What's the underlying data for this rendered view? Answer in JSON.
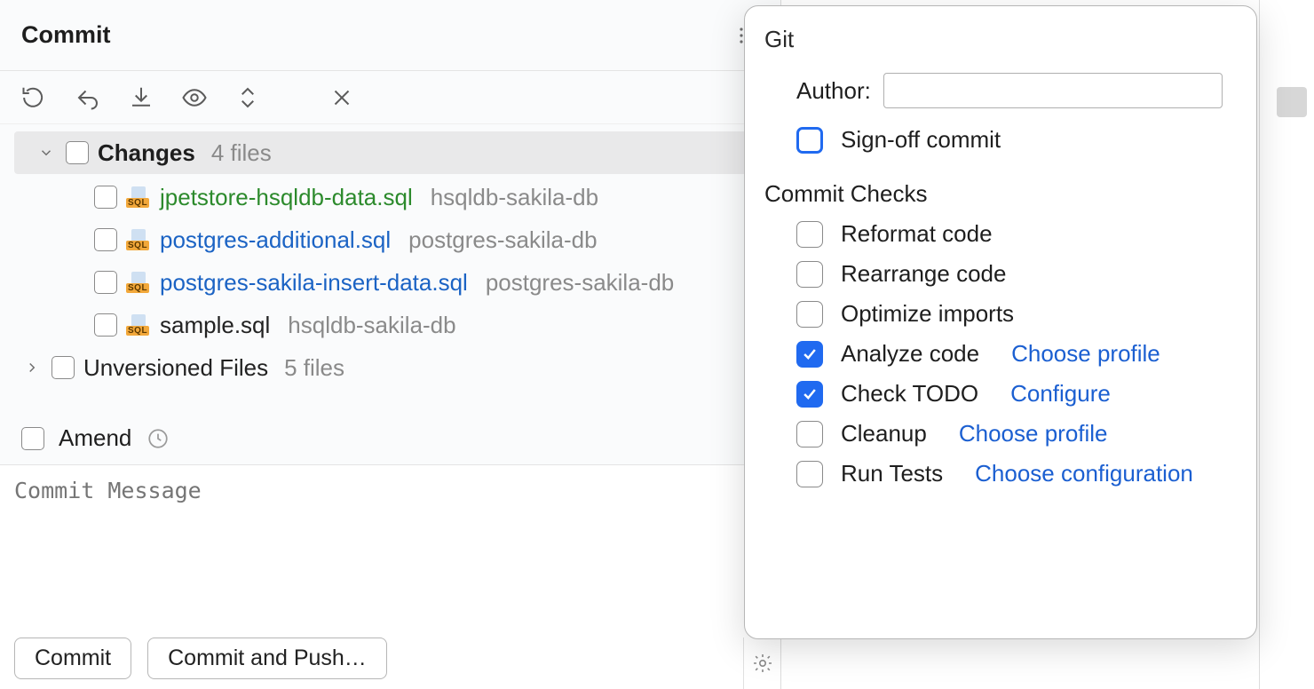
{
  "header": {
    "title": "Commit"
  },
  "toolbar": {
    "icons": [
      "refresh",
      "rollback",
      "shelve",
      "eye",
      "diff",
      "close"
    ]
  },
  "tree": {
    "changes_label": "Changes",
    "changes_count": "4 files",
    "files": [
      {
        "name": "jpetstore-hsqldb-data.sql",
        "location": "hsqldb-sakila-db",
        "status": "added"
      },
      {
        "name": "postgres-additional.sql",
        "location": "postgres-sakila-db",
        "status": "modified"
      },
      {
        "name": "postgres-sakila-insert-data.sql",
        "location": "postgres-sakila-db",
        "status": "modified"
      },
      {
        "name": "sample.sql",
        "location": "hsqldb-sakila-db",
        "status": "plain"
      }
    ],
    "unversioned_label": "Unversioned Files",
    "unversioned_count": "5 files"
  },
  "amend": {
    "label": "Amend"
  },
  "message": {
    "placeholder": "Commit Message"
  },
  "buttons": {
    "commit": "Commit",
    "commit_push": "Commit and Push…"
  },
  "popup": {
    "git_title": "Git",
    "author_label": "Author:",
    "author_value": "",
    "signoff_label": "Sign-off commit",
    "signoff_checked": false,
    "checks_title": "Commit Checks",
    "items": [
      {
        "label": "Reformat code",
        "checked": false,
        "link": ""
      },
      {
        "label": "Rearrange code",
        "checked": false,
        "link": ""
      },
      {
        "label": "Optimize imports",
        "checked": false,
        "link": ""
      },
      {
        "label": "Analyze code",
        "checked": true,
        "link": "Choose profile"
      },
      {
        "label": "Check TODO",
        "checked": true,
        "link": "Configure"
      },
      {
        "label": "Cleanup",
        "checked": false,
        "link": "Choose profile"
      },
      {
        "label": "Run Tests",
        "checked": false,
        "link": "Choose configuration"
      }
    ]
  }
}
